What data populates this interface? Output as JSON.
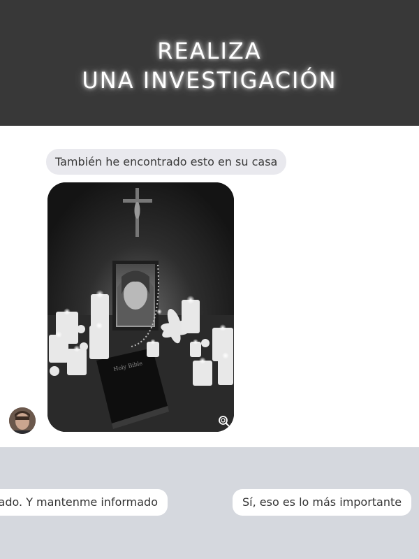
{
  "header": {
    "title_line1": "REALIZA",
    "title_line2": "UNA INVESTIGACIÓN"
  },
  "chat": {
    "message_text": "También he encontrado esto en su casa",
    "photo": {
      "book_title": "Holy Bible"
    }
  },
  "options": {
    "left_label": "ado. Y mantenme informado",
    "right_label": "Sí, eso es lo más importante"
  },
  "icons": {
    "zoom": "magnifier-icon",
    "avatar": "user-avatar"
  },
  "colors": {
    "header_bg": "#383838",
    "bubble_bg": "#e9e9ee",
    "options_bg": "#d5d8de"
  }
}
